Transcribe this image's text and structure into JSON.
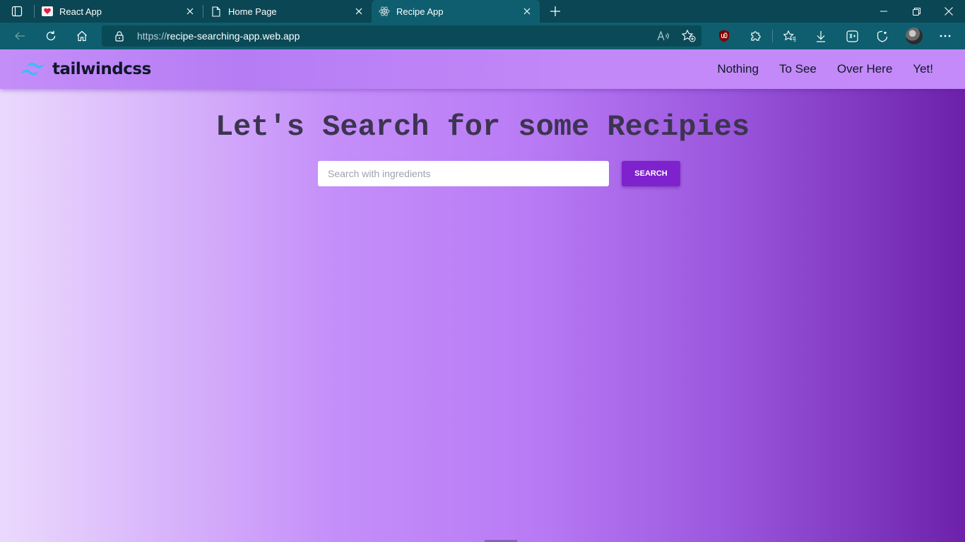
{
  "browser": {
    "tabs": [
      {
        "title": "React App",
        "icon": "heart-favicon",
        "active": false
      },
      {
        "title": "Home Page",
        "icon": "page-icon",
        "active": false
      },
      {
        "title": "Recipe App",
        "icon": "react-favicon",
        "active": true
      }
    ],
    "address": {
      "scheme": "https://",
      "host": "recipe-searching-app.web.app"
    }
  },
  "site": {
    "brand": "tailwindcss",
    "nav": [
      "Nothing",
      "To See",
      "Over Here",
      "Yet!"
    ]
  },
  "main": {
    "heading": "Let's Search for some Recipies",
    "search": {
      "placeholder": "Search with ingredients",
      "value": "",
      "button_label": "SEARCH"
    }
  },
  "colors": {
    "chrome": "#0e5e6f",
    "accent_button": "#7e22ce",
    "brand_logo": "#38bdf8"
  }
}
